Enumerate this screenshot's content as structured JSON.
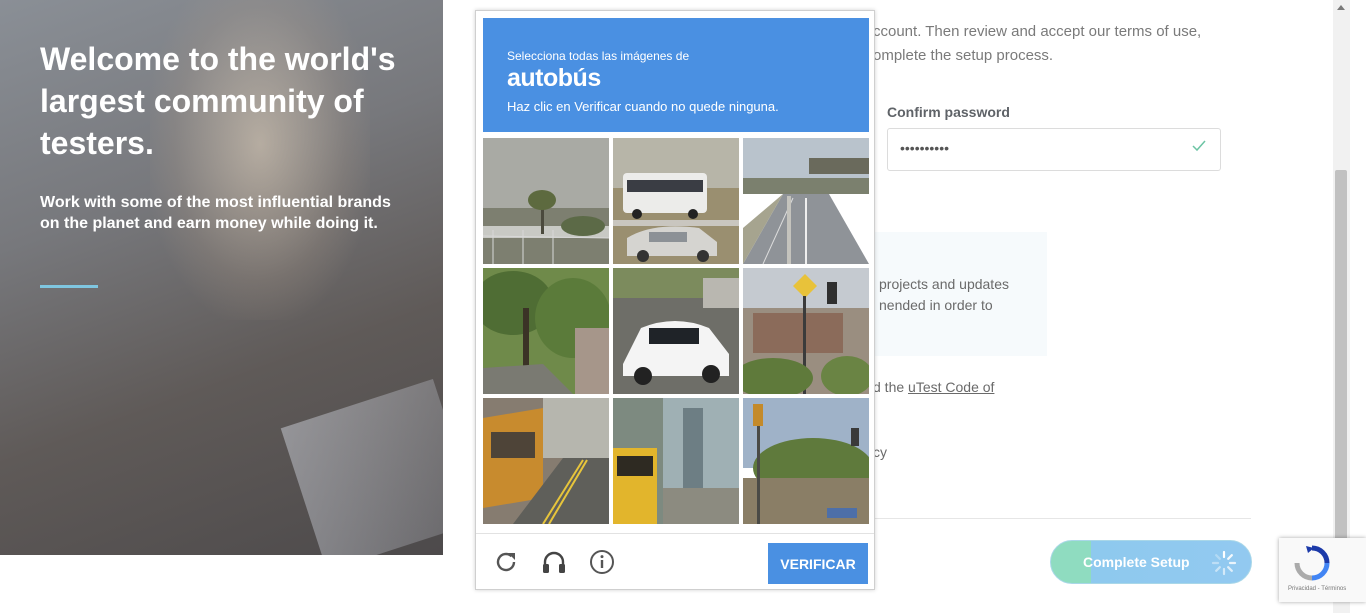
{
  "hero": {
    "title": "Welcome to the world's largest community of testers.",
    "subtitle": "Work with some of the most influential brands on the planet and earn money while doing it."
  },
  "form": {
    "intro_line1": "ccount. Then review and accept our terms of use,",
    "intro_line2": "omplete the setup process.",
    "confirm_password_label": "Confirm password",
    "confirm_password_value": "••••••••••",
    "notice_line1": "projects and updates",
    "notice_line2": "nended in order to",
    "agree_prefix": "d the",
    "agree_link": "uTest Code of",
    "policy_text": "cy",
    "complete_button": "Complete Setup"
  },
  "captcha": {
    "instruction": "Selecciona todas las imágenes de",
    "target": "autobús",
    "hint": "Haz clic en Verificar cuando no quede ninguna.",
    "verify_button": "VERIFICAR",
    "tiles": [
      "palm-tree-road",
      "bus-and-car",
      "highway-overpass",
      "trees-street",
      "white-car",
      "street-sign-building",
      "yellow-bus",
      "school-bus-building",
      "traffic-lights-street"
    ]
  },
  "badge": {
    "footer": "Privacidad - Términos"
  },
  "icons": {
    "reload": "reload-icon",
    "audio": "headphones-icon",
    "info": "info-icon",
    "check": "check-icon",
    "spinner": "spinner-icon",
    "recaptcha": "recaptcha-logo-icon"
  },
  "colors": {
    "captcha_blue": "#4a90e2",
    "accent_line": "#7fc6e0",
    "button_green": "#8fdcc0",
    "button_blue": "#8ec9ee"
  }
}
